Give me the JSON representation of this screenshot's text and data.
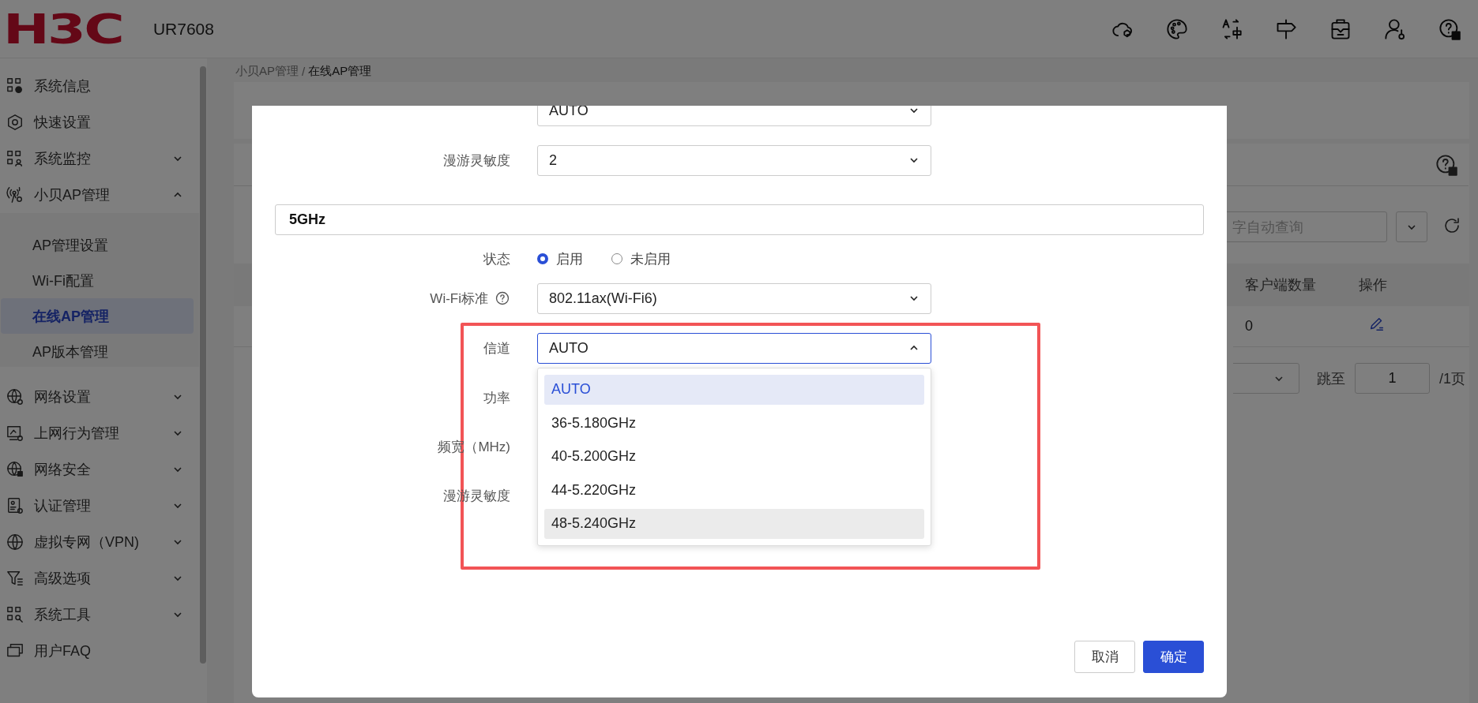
{
  "header": {
    "logo": "H3C",
    "model": "UR7608"
  },
  "sidebar": {
    "items": [
      {
        "kind": "link",
        "label": "系统信息"
      },
      {
        "kind": "link",
        "label": "快速设置"
      },
      {
        "kind": "group",
        "label": "系统监控",
        "expanded": false
      },
      {
        "kind": "group",
        "label": "小贝AP管理",
        "expanded": true,
        "children": [
          {
            "label": "AP管理设置",
            "selected": false
          },
          {
            "label": "Wi-Fi配置",
            "selected": false
          },
          {
            "label": "在线AP管理",
            "selected": true
          },
          {
            "label": "AP版本管理",
            "selected": false
          }
        ]
      },
      {
        "kind": "group",
        "label": "网络设置",
        "expanded": false
      },
      {
        "kind": "group",
        "label": "上网行为管理",
        "expanded": false
      },
      {
        "kind": "group",
        "label": "网络安全",
        "expanded": false
      },
      {
        "kind": "group",
        "label": "认证管理",
        "expanded": false
      },
      {
        "kind": "group",
        "label": "虚拟专网（VPN)",
        "expanded": false
      },
      {
        "kind": "group",
        "label": "高级选项",
        "expanded": false
      },
      {
        "kind": "group",
        "label": "系统工具",
        "expanded": false
      },
      {
        "kind": "link",
        "label": "用户FAQ"
      }
    ]
  },
  "breadcrumb": {
    "items": [
      "小贝AP管理",
      "在线AP管理"
    ],
    "separator": "/"
  },
  "list": {
    "search_placeholder": "字自动查询",
    "columns": [
      "客户端数量",
      "操作"
    ],
    "rows": [
      {
        "clients": "0"
      }
    ],
    "pagination": {
      "jump_label": "跳至",
      "page": "1",
      "total": "/1页"
    }
  },
  "dialog": {
    "rows": [
      {
        "kind": "select",
        "value": "AUTO",
        "expanded": false
      },
      {
        "kind": "select",
        "label": "漫游灵敏度",
        "value": "2",
        "expanded": false
      },
      {
        "kind": "section",
        "title": "5GHz"
      },
      {
        "kind": "radio",
        "label": "状态",
        "options": [
          {
            "label": "启用",
            "selected": true
          },
          {
            "label": "未启用",
            "selected": false
          }
        ]
      },
      {
        "kind": "select",
        "label": "Wi-Fi标准",
        "value": "802.11ax(Wi-Fi6)",
        "expanded": false,
        "help": true
      },
      {
        "kind": "select",
        "label": "信道",
        "value": "AUTO",
        "expanded": true,
        "options": [
          {
            "label": "AUTO",
            "selected": true,
            "hovered": false
          },
          {
            "label": "36-5.180GHz",
            "selected": false,
            "hovered": false
          },
          {
            "label": "40-5.200GHz",
            "selected": false,
            "hovered": false
          },
          {
            "label": "44-5.220GHz",
            "selected": false,
            "hovered": false
          },
          {
            "label": "48-5.240GHz",
            "selected": false,
            "hovered": true
          }
        ]
      },
      {
        "kind": "label",
        "label": "功率"
      },
      {
        "kind": "label",
        "label": "频宽（MHz)"
      },
      {
        "kind": "label",
        "label": "漫游灵敏度"
      }
    ],
    "buttons": [
      {
        "label": "取消",
        "kind": "secondary"
      },
      {
        "label": "确定",
        "kind": "primary"
      }
    ]
  }
}
